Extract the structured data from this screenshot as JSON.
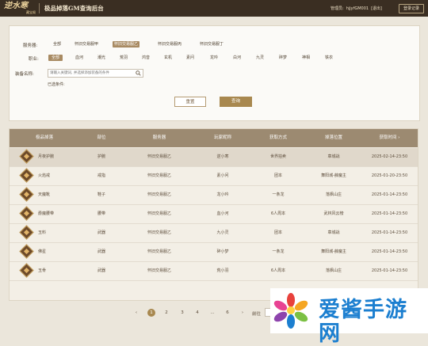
{
  "header": {
    "logo_text": "逆水寒",
    "logo_sub": "藏宝阁",
    "title": "极品掉落GM查询后台",
    "admin_label": "管理员:",
    "admin_name": "hjjyfGM001",
    "exit_label": "[退出]",
    "login_log": "登录记录"
  },
  "filters": {
    "server_label": "服务器:",
    "server_options": [
      "全部",
      "怀旧交易服甲",
      "怀旧交易服乙",
      "怀旧交易服丙",
      "怀旧交易服丁"
    ],
    "server_selected": "怀旧交易服乙",
    "class_label": "职业:",
    "class_options": [
      "全部",
      "血河",
      "潮光",
      "荒羽",
      "鸿音",
      "玄机",
      "素问",
      "龙吟",
      "白河",
      "九灵",
      "碎梦",
      "神相",
      "铁衣"
    ],
    "class_selected": "全部",
    "equip_label": "装备名称:",
    "equip_placeholder": "请输入关键词, 并选择添加装备的条件",
    "condition_label": "已选条件:",
    "reset_label": "重置",
    "query_label": "查询"
  },
  "table": {
    "columns": [
      "极品掉落",
      "部位",
      "服务器",
      "玩家昵称",
      "获取方式",
      "掉落位置",
      "获取时间"
    ],
    "sort_indicator": "›",
    "rows": [
      {
        "name": "月夜护腕",
        "slot": "护腕",
        "server": "怀旧交易服乙",
        "player": "逆小寒",
        "method": "世界拍卖",
        "location": "章城战",
        "time": "2025-02-14-23:50"
      },
      {
        "name": "火焰戒",
        "slot": "戒指",
        "server": "怀旧交易服乙",
        "player": "素小问",
        "method": "团本",
        "location": "舞阳城-薛魔主",
        "time": "2025-01-20-23:50"
      },
      {
        "name": "天魔靴",
        "slot": "鞋子",
        "server": "怀旧交易服乙",
        "player": "龙小吟",
        "method": "一条龙",
        "location": "落枫山庄",
        "time": "2025-01-14-23:50"
      },
      {
        "name": "爵魔腰带",
        "slot": "腰带",
        "server": "怀旧交易服乙",
        "player": "血小河",
        "method": "6人周本",
        "location": "武林风云榜",
        "time": "2025-01-14-23:50"
      },
      {
        "name": "玉料",
        "slot": "武器",
        "server": "怀旧交易服乙",
        "player": "九小灵",
        "method": "团本",
        "location": "章城战",
        "time": "2025-01-14-23:50"
      },
      {
        "name": "佛星",
        "slot": "武器",
        "server": "怀旧交易服乙",
        "player": "碎小梦",
        "method": "一条龙",
        "location": "舞阳城-薛魔主",
        "time": "2025-01-14-23:50"
      },
      {
        "name": "玉骨",
        "slot": "武器",
        "server": "怀旧交易服乙",
        "player": "荒小羽",
        "method": "6人周本",
        "location": "落枫山庄",
        "time": "2025-01-14-23:50"
      }
    ]
  },
  "pagination": {
    "prev": "‹",
    "pages": [
      "1",
      "2",
      "3",
      "4",
      "...",
      "6"
    ],
    "current": "1",
    "next": "›",
    "goto_label": "前往"
  },
  "watermark": {
    "text": "爱酱手游网"
  }
}
